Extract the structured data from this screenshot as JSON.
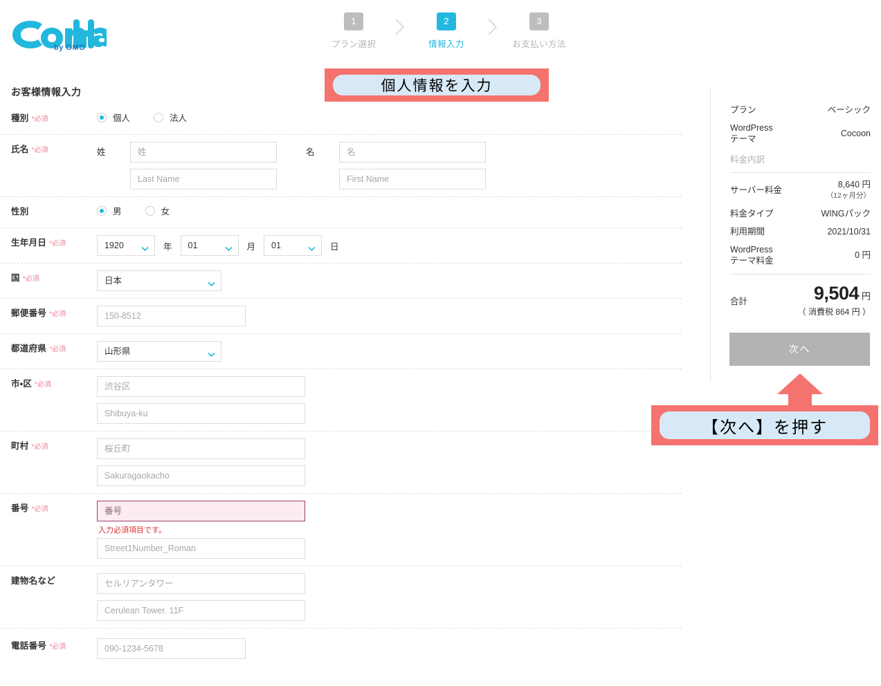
{
  "brand": {
    "logo_text": "ConoHa",
    "logo_sub": "by GMO",
    "logo_color": "#22b8dd",
    "accent_color": "#22b9e0"
  },
  "stepper": {
    "steps": [
      {
        "number": "1",
        "label": "プラン選択",
        "state": "inactive"
      },
      {
        "number": "2",
        "label": "情報入力",
        "state": "active"
      },
      {
        "number": "3",
        "label": "お支払い方法",
        "state": "inactive"
      }
    ]
  },
  "callouts": {
    "top": "個人情報を入力",
    "bottom": "【次へ】を押す",
    "frame_color": "#f4736f",
    "inner_color": "#d7e9f6"
  },
  "form": {
    "title": "お客様情報入力",
    "required_mark": "*必須",
    "rows": {
      "type": {
        "label": "種別",
        "options": [
          {
            "label": "個人",
            "selected": true
          },
          {
            "label": "法人",
            "selected": false
          }
        ]
      },
      "name": {
        "label": "氏名",
        "last_sub_label": "姓",
        "first_sub_label": "名",
        "last_jp_placeholder": "姓",
        "first_jp_placeholder": "名",
        "last_en_placeholder": "Last Name",
        "first_en_placeholder": "First Name",
        "last_jp_value": "",
        "first_jp_value": "",
        "last_en_value": "",
        "first_en_value": ""
      },
      "gender": {
        "label": "性別",
        "options": [
          {
            "label": "男",
            "selected": true
          },
          {
            "label": "女",
            "selected": false
          }
        ]
      },
      "birthday": {
        "label": "生年月日",
        "year_value": "1920",
        "month_value": "01",
        "day_value": "01",
        "year_unit": "年",
        "month_unit": "月",
        "day_unit": "日"
      },
      "country": {
        "label": "国",
        "value": "日本"
      },
      "postal": {
        "label": "郵便番号",
        "placeholder": "150-8512",
        "value": ""
      },
      "prefecture": {
        "label": "都道府県",
        "value": "山形県"
      },
      "city": {
        "label": "市・区",
        "jp_placeholder": "渋谷区",
        "en_placeholder": "Shibuya-ku",
        "jp_value": "",
        "en_value": ""
      },
      "town": {
        "label": "町村",
        "jp_placeholder": "桜丘町",
        "en_placeholder": "Sakuragaokacho",
        "jp_value": "",
        "en_value": ""
      },
      "street": {
        "label": "番号",
        "jp_placeholder": "番号",
        "en_placeholder": "Street1Number_Roman",
        "jp_value": "",
        "en_value": "",
        "error": "入力必須項目です。",
        "error_color": "#e03131"
      },
      "building": {
        "label": "建物名など",
        "jp_placeholder": "セルリアンタワー",
        "en_placeholder": "Cerulean Tower. 11F",
        "jp_value": "",
        "en_value": ""
      },
      "phone": {
        "label": "電話番号",
        "placeholder": "090-1234-5678",
        "value": ""
      }
    }
  },
  "sidebar": {
    "plan_key": "プラン",
    "plan_value": "ベーシック",
    "theme_key_line1": "WordPress",
    "theme_key_line2": "テーマ",
    "theme_value": "Cocoon",
    "breakdown_heading": "料金内訳",
    "server_fee_key": "サーバー料金",
    "server_fee_value": "8,640 円",
    "server_fee_sub": "（12ヶ月分）",
    "fee_type_key": "料金タイプ",
    "fee_type_value": "WINGパック",
    "period_key": "利用期間",
    "period_value": "2021/10/31",
    "theme_fee_key_line1": "WordPress",
    "theme_fee_key_line2": "テーマ料金",
    "theme_fee_value": "0 円",
    "total_key": "合計",
    "total_amount": "9,504",
    "total_unit": "円",
    "total_tax": "（ 消費税 864 円 ）",
    "next_button": "次へ"
  }
}
